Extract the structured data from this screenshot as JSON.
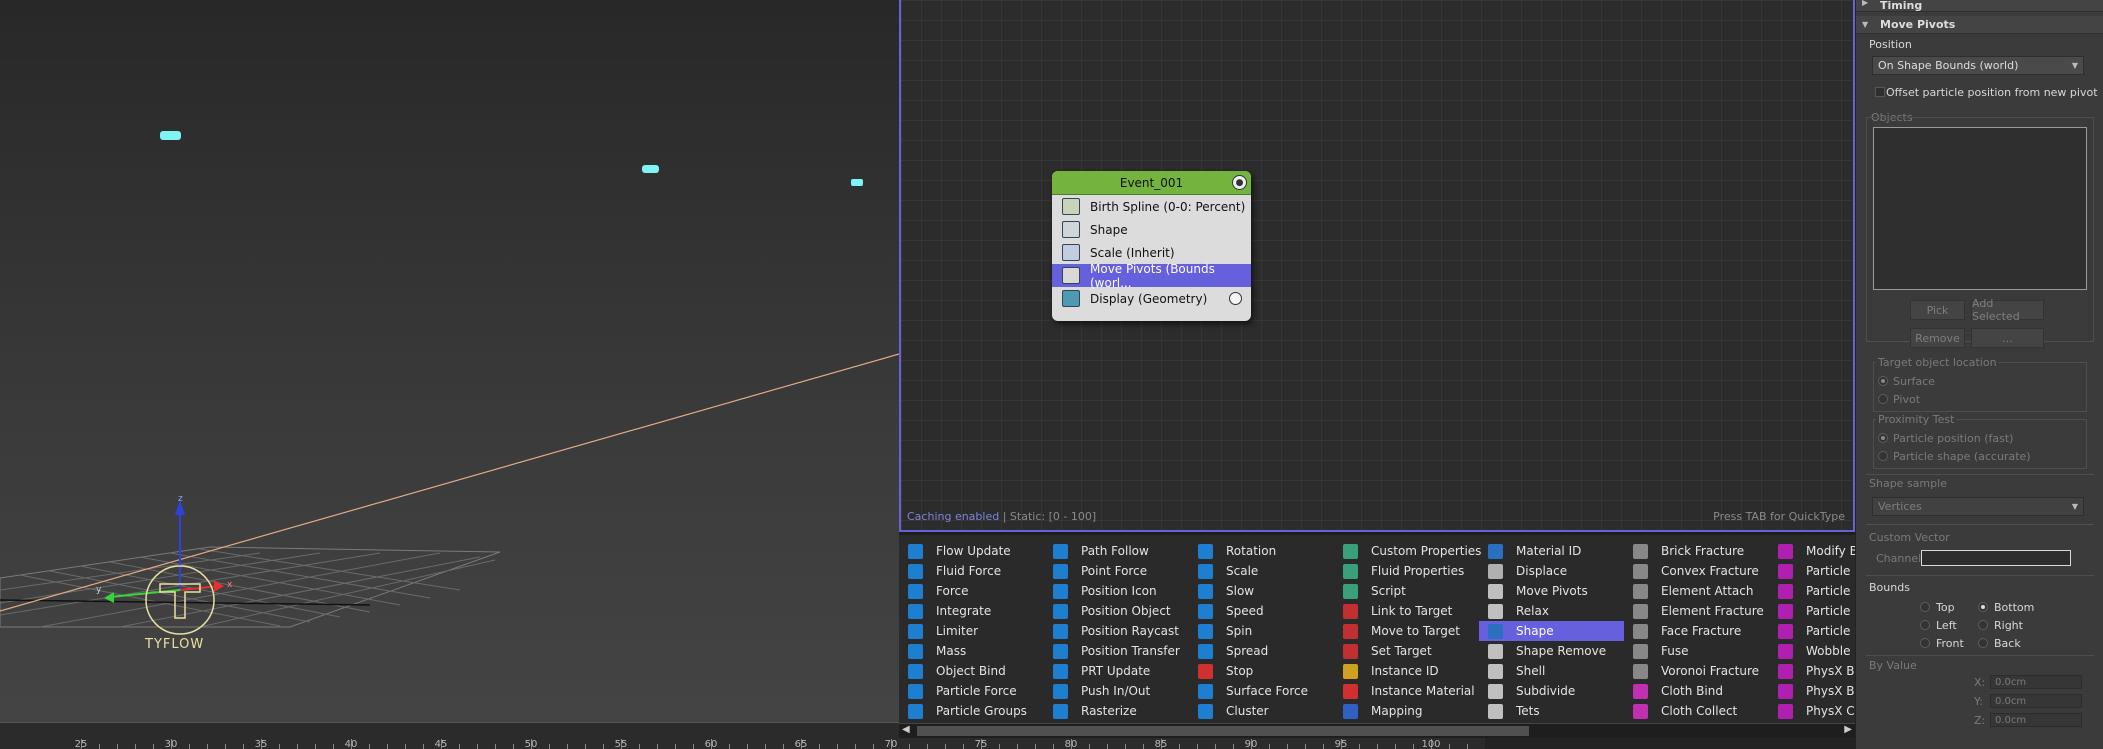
{
  "viewport": {
    "logo_text": "TYFLOW",
    "axis_x": "x",
    "axis_y": "y",
    "axis_z": "z",
    "ruler_labels": [
      "25",
      "30",
      "35",
      "40",
      "45",
      "50",
      "55",
      "60",
      "65",
      "70",
      "75",
      "80",
      "85",
      "90",
      "95",
      "100"
    ]
  },
  "graph": {
    "event_name": "Event_001",
    "operators": [
      {
        "label": "Birth Spline (0-0: Percent)"
      },
      {
        "label": "Shape"
      },
      {
        "label": "Scale (Inherit)"
      },
      {
        "label": "Move Pivots (Bounds (worl..."
      },
      {
        "label": "Display (Geometry)"
      }
    ],
    "status_caching": "Caching enabled",
    "status_static": "| Static: [0 - 100]",
    "status_hint": "Press TAB for QuickType"
  },
  "oplist": {
    "columns": [
      [
        "Flow Update",
        "Fluid Force",
        "Force",
        "Integrate",
        "Limiter",
        "Mass",
        "Object Bind",
        "Particle Force",
        "Particle Groups"
      ],
      [
        "Path Follow",
        "Point Force",
        "Position Icon",
        "Position Object",
        "Position Raycast",
        "Position Transfer",
        "PRT Update",
        "Push In/Out",
        "Rasterize"
      ],
      [
        "Rotation",
        "Scale",
        "Slow",
        "Speed",
        "Spin",
        "Spread",
        "Stop",
        "Surface Force",
        "Cluster"
      ],
      [
        "Custom Properties",
        "Fluid Properties",
        "Script",
        "Link to Target",
        "Move to Target",
        "Set Target",
        "Instance ID",
        "Instance Material",
        "Mapping"
      ],
      [
        "Material ID",
        "Displace",
        "Move Pivots",
        "Relax",
        "Shape",
        "Shape Remove",
        "Shell",
        "Subdivide",
        "Tets"
      ],
      [
        "Brick Fracture",
        "Convex Fracture",
        "Element Attach",
        "Element Fracture",
        "Face Fracture",
        "Fuse",
        "Voronoi Fracture",
        "Cloth Bind",
        "Cloth Collect"
      ],
      [
        "Modify B",
        "Particle B",
        "Particle B",
        "Particle P",
        "Particle S",
        "Wobble",
        "PhysX Bi",
        "PhysX Bo",
        "PhysX Co"
      ]
    ],
    "selected": "Shape"
  },
  "panel": {
    "timing_title": "Timing",
    "rollout_title": "Move Pivots",
    "position_label": "Position",
    "position_value": "On Shape Bounds (world)",
    "offset_label": "Offset particle position from new pivot",
    "objects_label": "Objects",
    "pick_label": "Pick",
    "add_selected_label": "Add Selected",
    "remove_label": "Remove",
    "more_label": "...",
    "target_location_label": "Target object location",
    "surface_label": "Surface",
    "pivot_label": "Pivot",
    "proximity_label": "Proximity Test",
    "prox_fast_label": "Particle position (fast)",
    "prox_accurate_label": "Particle shape (accurate)",
    "shape_sample_label": "Shape sample",
    "shape_sample_value": "Vertices",
    "custom_vector_label": "Custom Vector",
    "channel_label": "Channel:",
    "channel_value": "",
    "bounds_label": "Bounds",
    "top_label": "Top",
    "bottom_label": "Bottom",
    "left_label": "Left",
    "right_label": "Right",
    "front_label": "Front",
    "back_label": "Back",
    "by_value_label": "By Value",
    "x_label": "X:",
    "y_label": "Y:",
    "z_label": "Z:",
    "x_value": "0.0cm",
    "y_value": "0.0cm",
    "z_value": "0.0cm"
  },
  "colors": {
    "accent": "#6660dc",
    "event_header": "#74b43e",
    "particle": "#7ff4f4",
    "spline": "#e3a88a"
  }
}
